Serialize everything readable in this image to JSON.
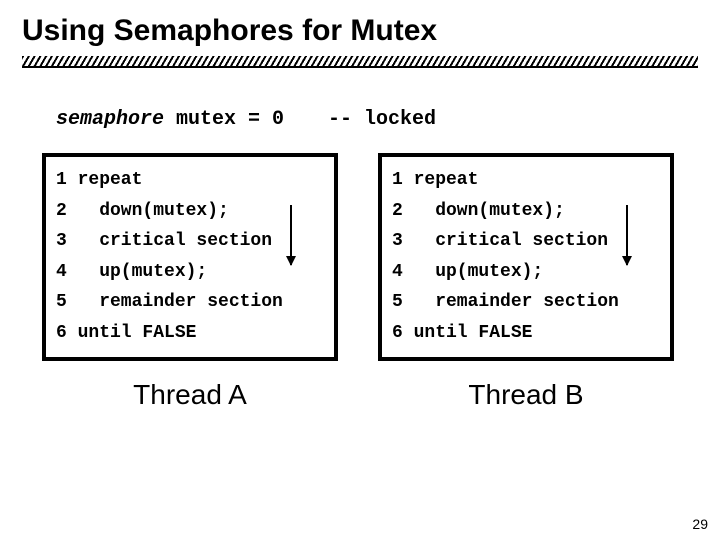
{
  "title": "Using Semaphores for Mutex",
  "decl": {
    "keyword": "semaphore",
    "expr": " mutex = 0",
    "comment": "-- locked"
  },
  "threadA": {
    "label": "Thread A",
    "lines": [
      "1 repeat",
      "2   down(mutex);",
      "3   critical section",
      "4   up(mutex);",
      "5   remainder section",
      "6 until FALSE"
    ]
  },
  "threadB": {
    "label": "Thread B",
    "lines": [
      "1 repeat",
      "2   down(mutex);",
      "3   critical section",
      "4   up(mutex);",
      "5   remainder section",
      "6 until FALSE"
    ]
  },
  "page_number": "29"
}
